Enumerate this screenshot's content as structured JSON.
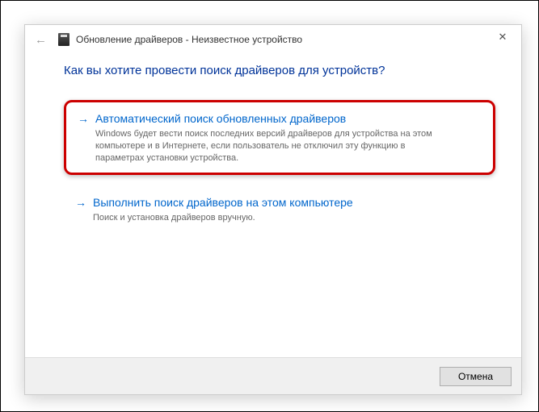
{
  "titlebar": {
    "back_icon_char": "←",
    "title": "Обновление драйверов - Неизвестное устройство",
    "close_char": "✕"
  },
  "heading": "Как вы хотите провести поиск драйверов для устройств?",
  "options": [
    {
      "arrow": "→",
      "title": "Автоматический поиск обновленных драйверов",
      "description": "Windows будет вести поиск последних версий драйверов для устройства на этом компьютере и в Интернете, если пользователь не отключил эту функцию в параметрах установки устройства.",
      "highlighted": true
    },
    {
      "arrow": "→",
      "title": "Выполнить поиск драйверов на этом компьютере",
      "description": "Поиск и установка драйверов вручную.",
      "highlighted": false
    }
  ],
  "footer": {
    "cancel_label": "Отмена"
  },
  "colors": {
    "link": "#0066cc",
    "heading": "#003399",
    "highlight_border": "#cc0000"
  }
}
